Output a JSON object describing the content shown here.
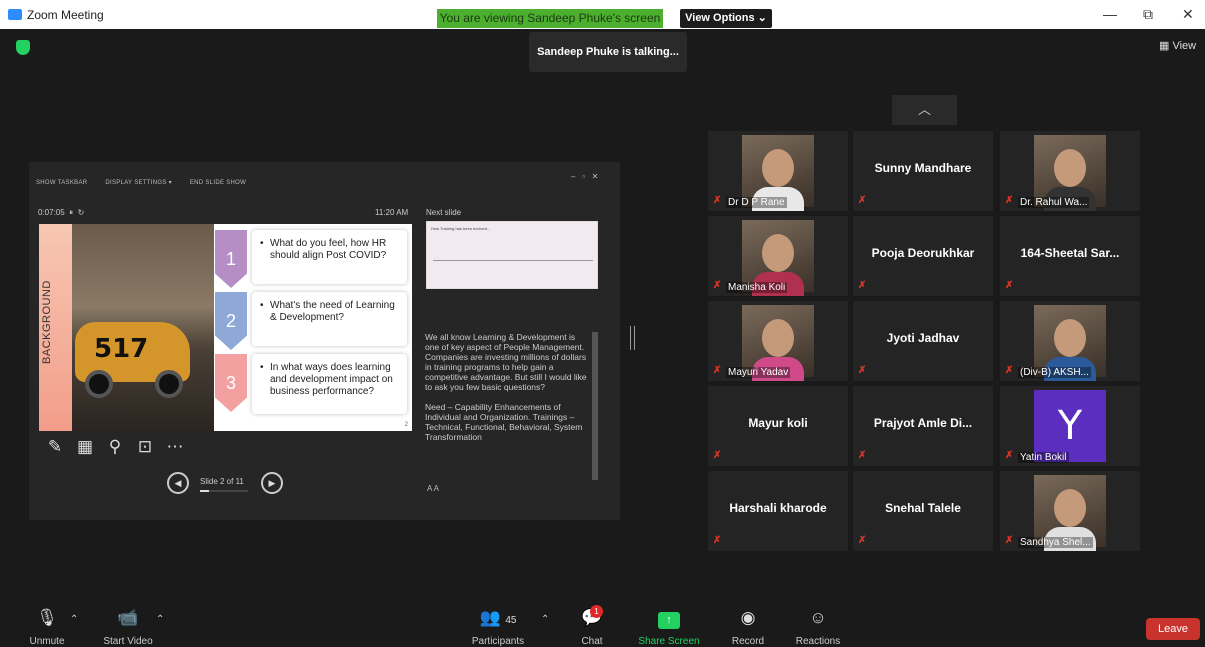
{
  "window": {
    "title": "Zoom Meeting",
    "viewing_banner": "You are viewing Sandeep Phuke's screen",
    "view_options": "View Options ⌄",
    "minimize": "—",
    "maximize": "⧉",
    "close": "✕"
  },
  "meeting": {
    "talking": "Sandeep Phuke is talking...",
    "view_label": "View"
  },
  "share": {
    "toolbar": [
      "SHOW TASKBAR",
      "DISPLAY SETTINGS ▾",
      "END SLIDE SHOW"
    ],
    "timer": "0:07:05",
    "clock": "11:20 AM",
    "next_slide_label": "Next slide",
    "next_slide_title": "How Training has been evolved...",
    "slide": {
      "band_label": "BACKGROUND",
      "car_number": "517",
      "page": "2",
      "items": [
        {
          "num": "1",
          "text": "What do you feel, how HR should align Post COVID?"
        },
        {
          "num": "2",
          "text": "What's the need of Learning & Development?"
        },
        {
          "num": "3",
          "text": "In what ways does learning and development impact on business performance?"
        }
      ]
    },
    "notes": [
      "We all know Learning & Development is one of key aspect of People Management. Companies are investing millions of dollars in training programs to help gain a competitive advantage. But still I would like to ask you few basic questions?",
      "Need – Capability Enhancements of Individual and Organization. Trainings – Technical, Functional, Behavioral, System Transformation"
    ],
    "font_controls": "A  A",
    "slide_counter": "Slide 2 of 11",
    "slide_progress": 0.18
  },
  "participants_gallery": [
    {
      "name": "Dr D P Rane",
      "display": "photo",
      "body": "#e8e8e8"
    },
    {
      "name": "Sunny Mandhare",
      "display": "name"
    },
    {
      "name": "Dr. Rahul Wa...",
      "display": "photo",
      "body": "#333333"
    },
    {
      "name": "Manisha Koli",
      "display": "photo",
      "body": "#b03050"
    },
    {
      "name": "Pooja Deorukhkar",
      "display": "name"
    },
    {
      "name": "164-Sheetal Sar...",
      "display": "name"
    },
    {
      "name": "Mayuri Yadav",
      "display": "photo",
      "body": "#d04a8a"
    },
    {
      "name": "Jyoti Jadhav",
      "display": "name"
    },
    {
      "name": "(Div-B) AKSH...",
      "display": "photo",
      "body": "#2a5a9a"
    },
    {
      "name": "Mayur koli",
      "display": "name"
    },
    {
      "name": "Prajyot Amle Di...",
      "display": "name"
    },
    {
      "name": "Yatin Bokil",
      "display": "avatar",
      "initial": "Y"
    },
    {
      "name": "Harshali kharode",
      "display": "name"
    },
    {
      "name": "Snehal Talele",
      "display": "name"
    },
    {
      "name": "Sandhya Shel...",
      "display": "photo",
      "body": "#e0e0e0"
    }
  ],
  "toolbar": {
    "unmute": "Unmute",
    "start_video": "Start Video",
    "participants": "Participants",
    "participant_count": "45",
    "chat": "Chat",
    "chat_badge": "1",
    "share_screen": "Share Screen",
    "record": "Record",
    "reactions": "Reactions",
    "leave": "Leave"
  },
  "colors": {
    "banner_green": "#4caf2f",
    "accent_green": "#23d160",
    "muted_red": "#d9362b",
    "leave_red": "#c8332d",
    "avatar_purple": "#5b2ec0"
  }
}
